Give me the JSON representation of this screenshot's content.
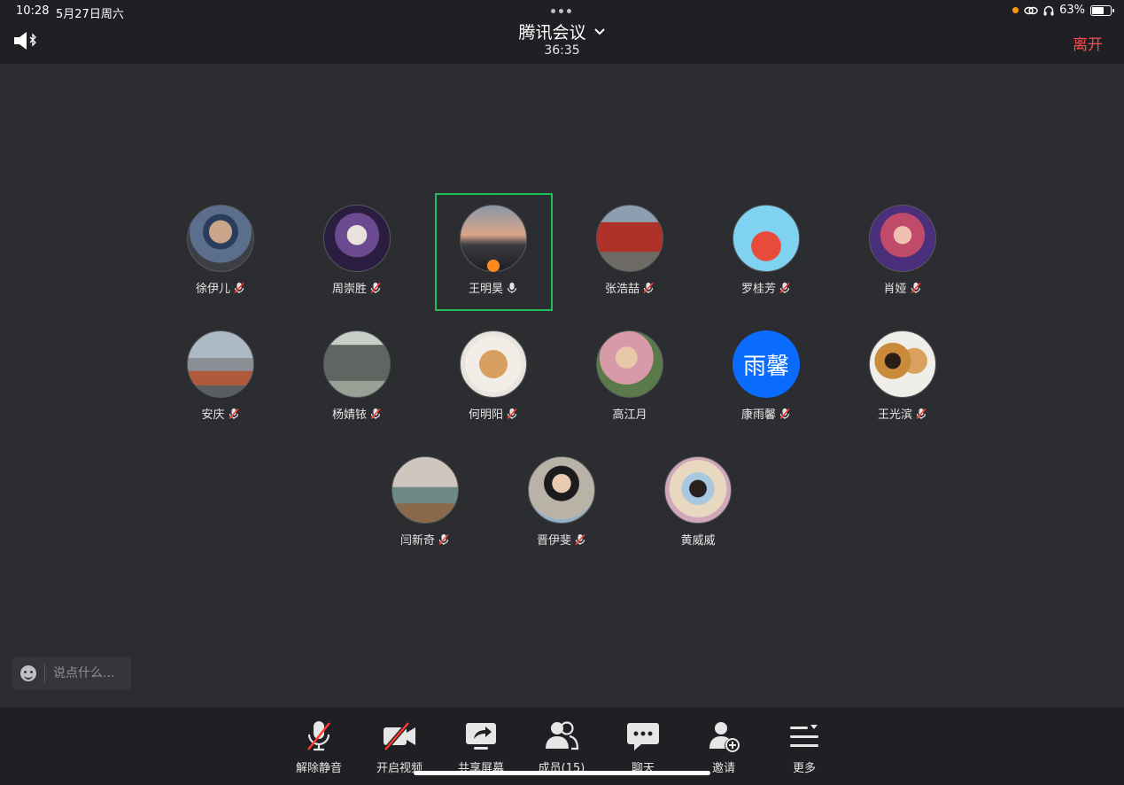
{
  "status_bar": {
    "time": "10:28",
    "date": "5月27日周六",
    "battery": "63%"
  },
  "header": {
    "title": "腾讯会议",
    "timer": "36:35",
    "leave_label": "离开"
  },
  "participants": [
    {
      "name": "徐伊儿",
      "muted": true
    },
    {
      "name": "周崇胜",
      "muted": true
    },
    {
      "name": "王明昊",
      "muted": false,
      "speaking": true,
      "host": true
    },
    {
      "name": "张浩喆",
      "muted": true
    },
    {
      "name": "罗桂芳",
      "muted": true
    },
    {
      "name": "肖娅",
      "muted": true
    },
    {
      "name": "安庆",
      "muted": true
    },
    {
      "name": "杨婧铱",
      "muted": true
    },
    {
      "name": "何明阳",
      "muted": true
    },
    {
      "name": "高江月",
      "muted": null
    },
    {
      "name": "康雨馨",
      "muted": true,
      "avatar_text": "雨馨"
    },
    {
      "name": "王光滨",
      "muted": true
    },
    {
      "name": "闫新奇",
      "muted": true
    },
    {
      "name": "晋伊斐",
      "muted": true
    },
    {
      "name": "黄威威",
      "muted": null
    }
  ],
  "chat": {
    "placeholder": "说点什么..."
  },
  "toolbar": {
    "unmute": "解除静音",
    "video": "开启视频",
    "share": "共享屏幕",
    "members": "成员(15)",
    "chat": "聊天",
    "invite": "邀请",
    "more": "更多"
  },
  "colors": {
    "background": "#2b2d30",
    "bar": "#1f2023",
    "leave": "#ff4d4f",
    "active_speaker": "#1fc05a",
    "muted_slash": "#ff3b30",
    "text_avatar": "#0a6cff"
  }
}
